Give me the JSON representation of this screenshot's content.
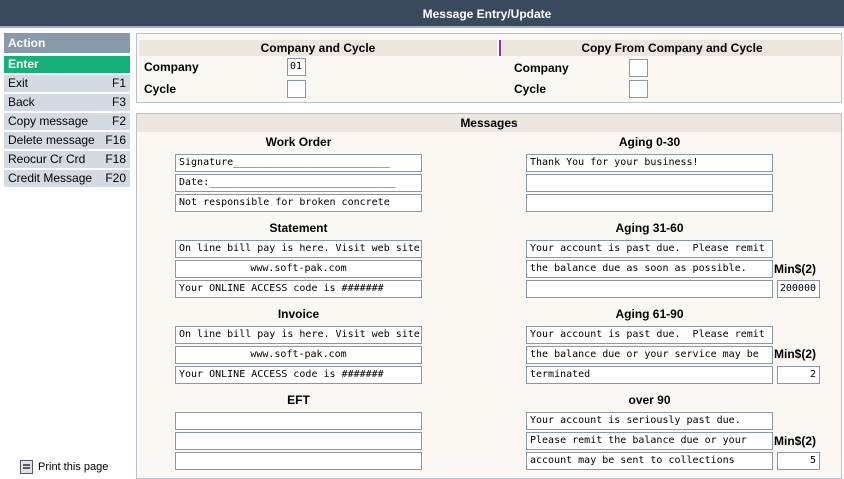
{
  "window": {
    "title": "Message Entry/Update"
  },
  "sidebar": {
    "header": "Action",
    "items": [
      {
        "label": "Enter",
        "key": ""
      },
      {
        "label": "Exit",
        "key": "F1"
      },
      {
        "label": "Back",
        "key": "F3"
      },
      {
        "label": "Copy message",
        "key": "F2"
      },
      {
        "label": "Delete message",
        "key": "F16"
      },
      {
        "label": "Reocur Cr Crd",
        "key": "F18"
      },
      {
        "label": "Credit Message",
        "key": "F20"
      }
    ],
    "print_label": "Print this page"
  },
  "company_cycle": {
    "left_header": "Company and Cycle",
    "right_header": "Copy From Company and Cycle",
    "company_label": "Company",
    "cycle_label": "Cycle",
    "company_value": "01",
    "cycle_value": "",
    "copy_company_value": "",
    "copy_cycle_value": ""
  },
  "messages": {
    "header": "Messages",
    "min_label": "Min$(2)",
    "work_order": {
      "title": "Work Order",
      "lines": [
        "Signature__________________________",
        "Date:_______________________________",
        "Not responsible for broken concrete"
      ]
    },
    "statement": {
      "title": "Statement",
      "lines": [
        "On line bill pay is here. Visit web site",
        "www.soft-pak.com",
        "Your ONLINE ACCESS code is #######"
      ]
    },
    "invoice": {
      "title": "Invoice",
      "lines": [
        "On line bill pay is here. Visit web site",
        "www.soft-pak.com",
        "Your ONLINE ACCESS code is #######"
      ]
    },
    "eft": {
      "title": "EFT",
      "lines": [
        "",
        "",
        ""
      ]
    },
    "aging_0_30": {
      "title": "Aging 0-30",
      "lines": [
        "Thank You for your business!",
        "",
        ""
      ]
    },
    "aging_31_60": {
      "title": "Aging 31-60",
      "lines": [
        "Your account is past due.  Please remit",
        "the balance due as soon as possible.",
        ""
      ],
      "min": "200000"
    },
    "aging_61_90": {
      "title": "Aging 61-90",
      "lines": [
        "Your account is past due.  Please remit",
        "the balance due or your service may be",
        "terminated"
      ],
      "min": "2"
    },
    "over_90": {
      "title": "over 90",
      "lines": [
        "Your account is seriously past due.",
        "Please remit the balance due or your",
        "account may be sent to collections"
      ],
      "min": "5"
    }
  }
}
